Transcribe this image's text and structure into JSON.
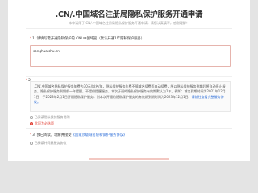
{
  "page": {
    "title": ".CN/.中国域名注册局隐私保护服务开通申请",
    "subtitle": "本申请用于.CN/.中国域名注册局隐私保护服务开通申请，请您认真填写，感谢理解！"
  },
  "question1": {
    "number": "1.",
    "label": "请填写需开通隐私保护的.CN/.中国域名（默认开通1年隐私保护服务）",
    "value": "songhuaishu.cn"
  },
  "question2": {
    "number": "2.",
    "notice_text": ".CN/.中国域名隐私保护服务年费为30元/域名/年，隐私保护服务年费不随域名续费而自动续费，所以隐私保护服务到期后将自动停止服务，隐私保护服务到期前一年提醒，不提供提醒服务，本次开通的隐私保护服务有效期默认为1年。例如：域名到期时间为2021年12月1日，于2023年2月1日开通隐私保护服务，则本次开通的隐私保护服务的有效期到期时间为2023年12月1日。",
    "notice_link": "请前往查看完整服务协议。",
    "hint": "已阅读隐私保护服务说明",
    "warning": "此项为必选项"
  },
  "question3": {
    "number": "3.",
    "label_prefix": "我已阅读，理解并接受",
    "label_link": "《国家顶级域名隐私保护服务协议》",
    "hint": "已阅读并同意服务协议"
  }
}
